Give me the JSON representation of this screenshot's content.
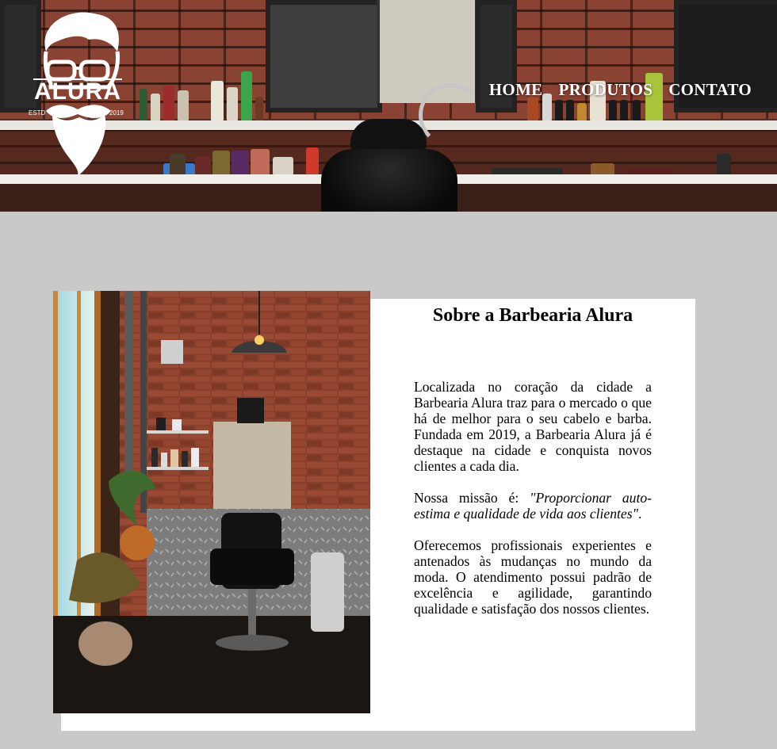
{
  "brand": {
    "logo_text": "ALURA",
    "logo_est": "ESTD",
    "logo_year": "2019"
  },
  "nav": {
    "items": [
      {
        "label": "HOME"
      },
      {
        "label": "PRODUTOS"
      },
      {
        "label": "CONTATO"
      }
    ]
  },
  "about": {
    "title": "Sobre a Barbearia Alura",
    "paragraph1": "Localizada no coração da cidade a Barbearia Alura traz para o mercado o que há de melhor para o seu cabelo e barba. Fundada em 2019, a Barbearia Alura já é destaque na cidade e conquista novos clientes a cada dia.",
    "mission_prefix": "Nossa missão é: ",
    "mission_quote": "\"Proporcionar auto-estima e qualidade de vida aos clientes\"",
    "mission_suffix": ".",
    "paragraph3": "Oferecemos profissionais experientes e antenados às mudanças no mundo da moda. O atendimento possui padrão de excelência e agilidade, garantindo qualidade e satisfação dos nossos clientes."
  },
  "colors": {
    "page_background": "#c9c9c9",
    "card_background": "#ffffff",
    "nav_text": "#ffffff"
  }
}
